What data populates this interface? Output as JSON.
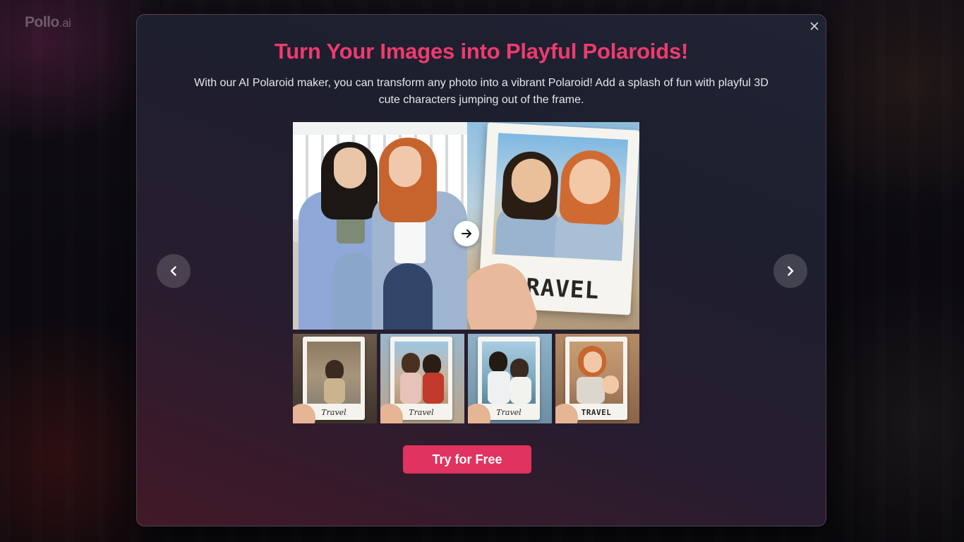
{
  "background": {
    "logo_main": "Pollo",
    "logo_suffix": ".ai"
  },
  "modal": {
    "title": "Turn Your Images into Playful Polaroids!",
    "description": "With our AI Polaroid maker, you can transform any photo into a vibrant Polaroid! Add a splash of fun with playful 3D cute characters jumping out of the frame.",
    "cta_label": "Try for Free",
    "close_icon": "close-icon",
    "prev_icon": "chevron-left-icon",
    "next_icon": "chevron-right-icon",
    "compare_icon": "arrow-right-icon",
    "preview": {
      "polaroid_caption": "TRAVEL"
    },
    "thumbnails": [
      {
        "caption": "Travel"
      },
      {
        "caption": "Travel"
      },
      {
        "caption": "Travel"
      },
      {
        "caption": "TRAVEL"
      }
    ]
  },
  "colors": {
    "title_pink": "#f03a6e",
    "cta_bg": "#e0335f",
    "modal_bg": "#262434"
  }
}
